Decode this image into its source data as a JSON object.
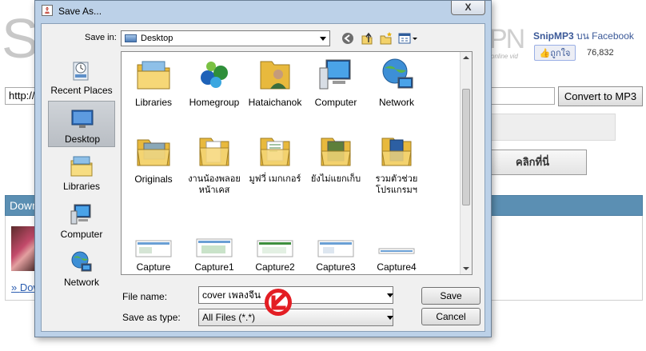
{
  "background_page": {
    "logo_letter": "S",
    "logo_right_text": "PN",
    "logo_small_text": "online vid",
    "fb_title": "SnipMP3",
    "fb_title_suffix": "บน Facebook",
    "fb_like_label": "ถูกใจ",
    "fb_like_count": "76,832",
    "url_input_value": "http://",
    "convert_button_label": "Convert to MP3",
    "click_button_label": "คลิกที่นี่",
    "download_bar_label": "Down",
    "download_link_label": "Dow"
  },
  "dialog": {
    "title": "Save As...",
    "close_label": "X",
    "save_in_label": "Save in:",
    "save_in_value": "Desktop",
    "toolbar": {
      "back_icon": "back-arrow-icon",
      "up_icon": "up-folder-icon",
      "new_folder_icon": "new-folder-icon",
      "view_menu_icon": "view-menu-icon"
    },
    "places": [
      {
        "label": "Recent Places",
        "icon": "recent-places-icon"
      },
      {
        "label": "Desktop",
        "icon": "desktop-icon",
        "selected": true
      },
      {
        "label": "Libraries",
        "icon": "libraries-icon"
      },
      {
        "label": "Computer",
        "icon": "computer-icon"
      },
      {
        "label": "Network",
        "icon": "network-icon"
      }
    ],
    "files": [
      {
        "name": "Libraries",
        "icon": "libraries-folder-icon"
      },
      {
        "name": "Homegroup",
        "icon": "homegroup-icon"
      },
      {
        "name": "Hataichanok",
        "icon": "user-folder-icon"
      },
      {
        "name": "Computer",
        "icon": "computer-icon"
      },
      {
        "name": "Network",
        "icon": "network-icon"
      },
      {
        "name": "Originals",
        "icon": "folder-icon"
      },
      {
        "name": "งานน้องพลอย",
        "name2": "หน้าเคส",
        "icon": "folder-icon"
      },
      {
        "name": "มูฟวี่ เมกเกอร์",
        "icon": "folder-icon"
      },
      {
        "name": "ยังไม่แยกเก็บ",
        "icon": "folder-icon"
      },
      {
        "name": "รวมตัวช่วย",
        "name2": "โปรแกรมฯ",
        "icon": "folder-icon"
      },
      {
        "name": "Capture",
        "icon": "image-file-icon"
      },
      {
        "name": "Capture1",
        "icon": "image-file-icon"
      },
      {
        "name": "Capture2",
        "icon": "image-file-icon"
      },
      {
        "name": "Capture3",
        "icon": "image-file-icon"
      },
      {
        "name": "Capture4",
        "icon": "image-file-icon"
      }
    ],
    "file_name_label": "File name:",
    "file_name_value": "cover เพลงจีน",
    "save_as_type_label": "Save as type:",
    "save_as_type_value": "All Files (*.*)",
    "save_button_label": "Save",
    "cancel_button_label": "Cancel"
  },
  "colors": {
    "dialog_frame": "#bcd1e8",
    "selection": "#c4c9cf",
    "cursor_mark": "#e31e24",
    "facebook": "#3b5998",
    "download_bar": "#5b8fb3"
  }
}
